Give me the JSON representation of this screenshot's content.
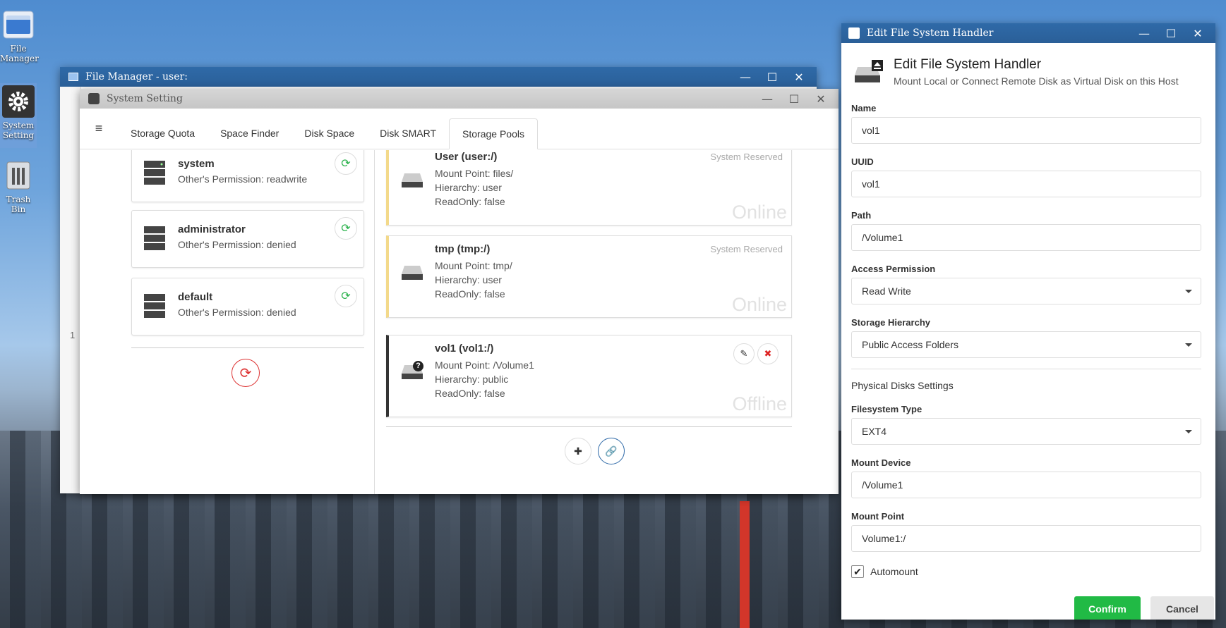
{
  "desktop": {
    "icons": [
      {
        "label_line1": "File",
        "label_line2": "Manager"
      },
      {
        "label_line1": "System",
        "label_line2": "Setting"
      },
      {
        "label_line1": "Trash Bin",
        "label_line2": ""
      }
    ]
  },
  "file_manager": {
    "title": "File Manager - user:",
    "side_number": "1"
  },
  "system_setting": {
    "title": "System Setting",
    "tabs": [
      "Storage Quota",
      "Space Finder",
      "Disk Space",
      "Disk SMART",
      "Storage Pools"
    ],
    "active_tab": "Storage Pools",
    "users": [
      {
        "name": "system",
        "permission": "Other's Permission: readwrite"
      },
      {
        "name": "administrator",
        "permission": "Other's Permission: denied"
      },
      {
        "name": "default",
        "permission": "Other's Permission: denied"
      }
    ],
    "pools": [
      {
        "title": "User (user:/)",
        "mount": "Mount Point: files/",
        "hierarchy": "Hierarchy: user",
        "readonly": "ReadOnly: false",
        "badge": "System Reserved",
        "status": "Online"
      },
      {
        "title": "tmp (tmp:/)",
        "mount": "Mount Point: tmp/",
        "hierarchy": "Hierarchy: user",
        "readonly": "ReadOnly: false",
        "badge": "System Reserved",
        "status": "Online"
      },
      {
        "title": "vol1 (vol1:/)",
        "mount": "Mount Point: /Volume1",
        "hierarchy": "Hierarchy: public",
        "readonly": "ReadOnly: false",
        "badge": "",
        "status": "Offline"
      }
    ]
  },
  "dialog": {
    "title": "Edit File System Handler",
    "heading": "Edit File System Handler",
    "subheading": "Mount Local or Connect Remote Disk as Virtual Disk on this Host",
    "fields": {
      "name_label": "Name",
      "name_value": "vol1",
      "uuid_label": "UUID",
      "uuid_value": "vol1",
      "path_label": "Path",
      "path_value": "/Volume1",
      "access_label": "Access Permission",
      "access_value": "Read Write",
      "hierarchy_label": "Storage Hierarchy",
      "hierarchy_value": "Public Access Folders",
      "physical_section": "Physical Disks Settings",
      "fstype_label": "Filesystem Type",
      "fstype_value": "EXT4",
      "device_label": "Mount Device",
      "device_value": "/Volume1",
      "mountpoint_label": "Mount Point",
      "mountpoint_value": "Volume1:/",
      "automount_label": "Automount"
    },
    "confirm_label": "Confirm",
    "cancel_label": "Cancel"
  },
  "glyphs": {
    "minimize": "—",
    "maximize": "☐",
    "close": "✕",
    "hamburger": "≡",
    "refresh": "⟳",
    "plus": "✚",
    "link": "🔗",
    "edit": "✎",
    "delete": "✖",
    "check": "✔",
    "question": "?"
  }
}
